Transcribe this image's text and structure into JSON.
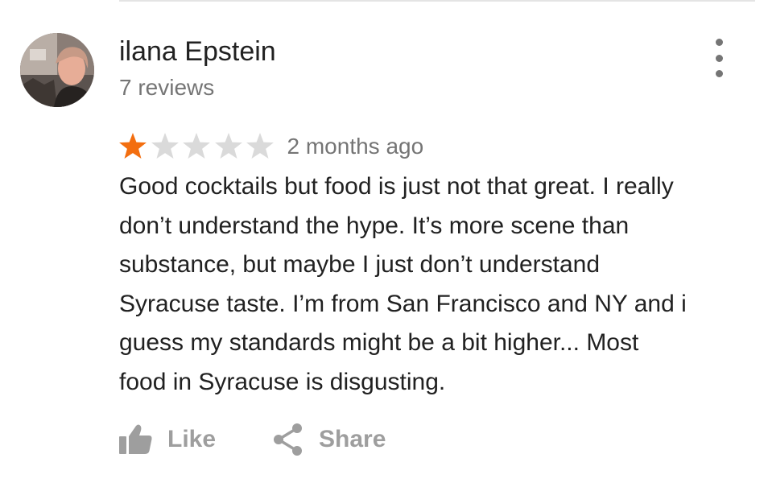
{
  "review": {
    "author": "ilana Epstein",
    "review_count": "7 reviews",
    "rating": 1,
    "max_rating": 5,
    "date": "2 months ago",
    "text": "Good cocktails but food is just not that great.  I really\ndon’t understand the hype.  It’s more scene than\nsubstance, but maybe I just don’t understand\nSyracuse taste.  I’m from San Francisco and NY and i\nguess my standards might be a bit higher...  Most\nfood in Syracuse is disgusting."
  },
  "actions": {
    "like_label": "Like",
    "share_label": "Share"
  },
  "icons": {
    "menu": "more-vert-icon",
    "like": "thumb-up-icon",
    "share": "share-icon"
  },
  "colors": {
    "star_filled": "#F36E0F",
    "star_empty": "#DADADA",
    "primary_text": "#212121",
    "secondary_text": "#757575",
    "action_text": "#9E9E9E"
  }
}
